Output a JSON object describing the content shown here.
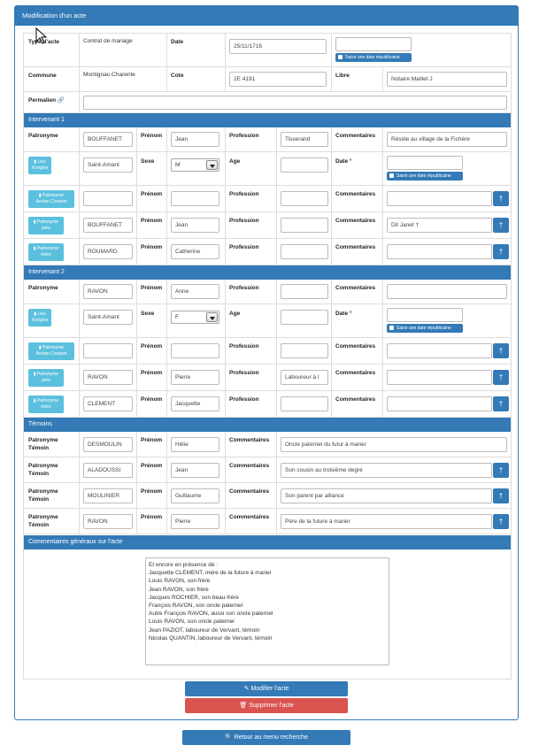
{
  "panel_title": "Modification d'un acte",
  "acte": {
    "type_label": "Type d'acte",
    "type_value": "Contrat de mariage",
    "date_label": "Date",
    "date_value": "25/11/1716",
    "rep_label": "Saisir une date républicaine",
    "commune_label": "Commune",
    "commune_value": "Montignac-Charente",
    "cote_label": "Cote",
    "cote_value": "2E 4191",
    "libre_label": "Libre",
    "libre_value": "Notaire Maillet J",
    "permalien_label": "Permalien"
  },
  "labels": {
    "patronyme": "Patronyme",
    "prenom": "Prénom",
    "profession": "Profession",
    "commentaires": "Commentaires",
    "sexe": "Sexe",
    "age": "Age",
    "date_star": "Date °",
    "patronyme_temoin_1": "Patronyme",
    "patronyme_temoin_2": "Témoin",
    "lieu_btn_1": "Lieu",
    "lieu_btn_2": "d'origine",
    "ancien_btn_1": "Patronyme",
    "ancien_btn_2": "Ancien Conjoint",
    "pere_btn_1": "Patronyme",
    "pere_btn_2": "père",
    "mere_btn_1": "Patronyme",
    "mere_btn_2": "mère",
    "dagger": "†"
  },
  "intervenant1": {
    "title": "Intervenant 1",
    "patronyme": "BOUFFANET",
    "prenom": "Jean",
    "profession": "Tisserand",
    "commentaires": "Réside au village de la Fichère",
    "lieu": "Saint-Amant",
    "sexe": "M",
    "pere_patronyme": "BOUFFANET",
    "pere_prenom": "Jean",
    "pere_commentaires": "Dit Janet †",
    "mere_patronyme": "ROUMARD",
    "mere_prenom": "Catherine"
  },
  "intervenant2": {
    "title": "Intervenant 2",
    "patronyme": "RAVON",
    "prenom": "Anne",
    "lieu": "Saint-Amant",
    "sexe": "F",
    "pere_patronyme": "RAVON",
    "pere_prenom": "Pierre",
    "pere_profession": "Laboureur à l",
    "mere_patronyme": "CLEMENT",
    "mere_prenom": "Jacquette"
  },
  "temoins": {
    "title": "Témoins",
    "rows": [
      {
        "patronyme": "DESMOULIN",
        "prenom": "Hélie",
        "commentaires": "Oncle paternel du futur à marier"
      },
      {
        "patronyme": "ALADOUSSI",
        "prenom": "Jean",
        "commentaires": "Son cousin au troisième degré"
      },
      {
        "patronyme": "MOULINIER",
        "prenom": "Guillaume",
        "commentaires": "Son parent par alliance"
      },
      {
        "patronyme": "RAVON",
        "prenom": "Pierre",
        "commentaires": "Père de la future à marier"
      }
    ]
  },
  "general": {
    "title": "Commentaires généraux sur l'acte",
    "lines": [
      "Et encore en présence de :",
      "Jacquette CLEMENT, mère de la future à marier",
      "Louis RAVON, son frère",
      "Jean RAVON, son frère",
      "Jacques ROCHIER, son beau-frère",
      "François RAVON, son oncle paternel",
      "Autre François RAVON, aussi son oncle paternel",
      "Louis RAVON, son oncle paternel",
      "Jean PAZIOT, laboureur de Vervant, témoin",
      "Nicolas QUANTIN, laboureur de Vervant, témoin"
    ]
  },
  "buttons": {
    "modifier": "Modifier l'acte",
    "supprimer": "Supprimer l'acte",
    "retour": "Retour au menu recherche"
  },
  "colors": {
    "primary": "#337ab7",
    "info": "#5bc0de",
    "danger": "#d9534f"
  }
}
